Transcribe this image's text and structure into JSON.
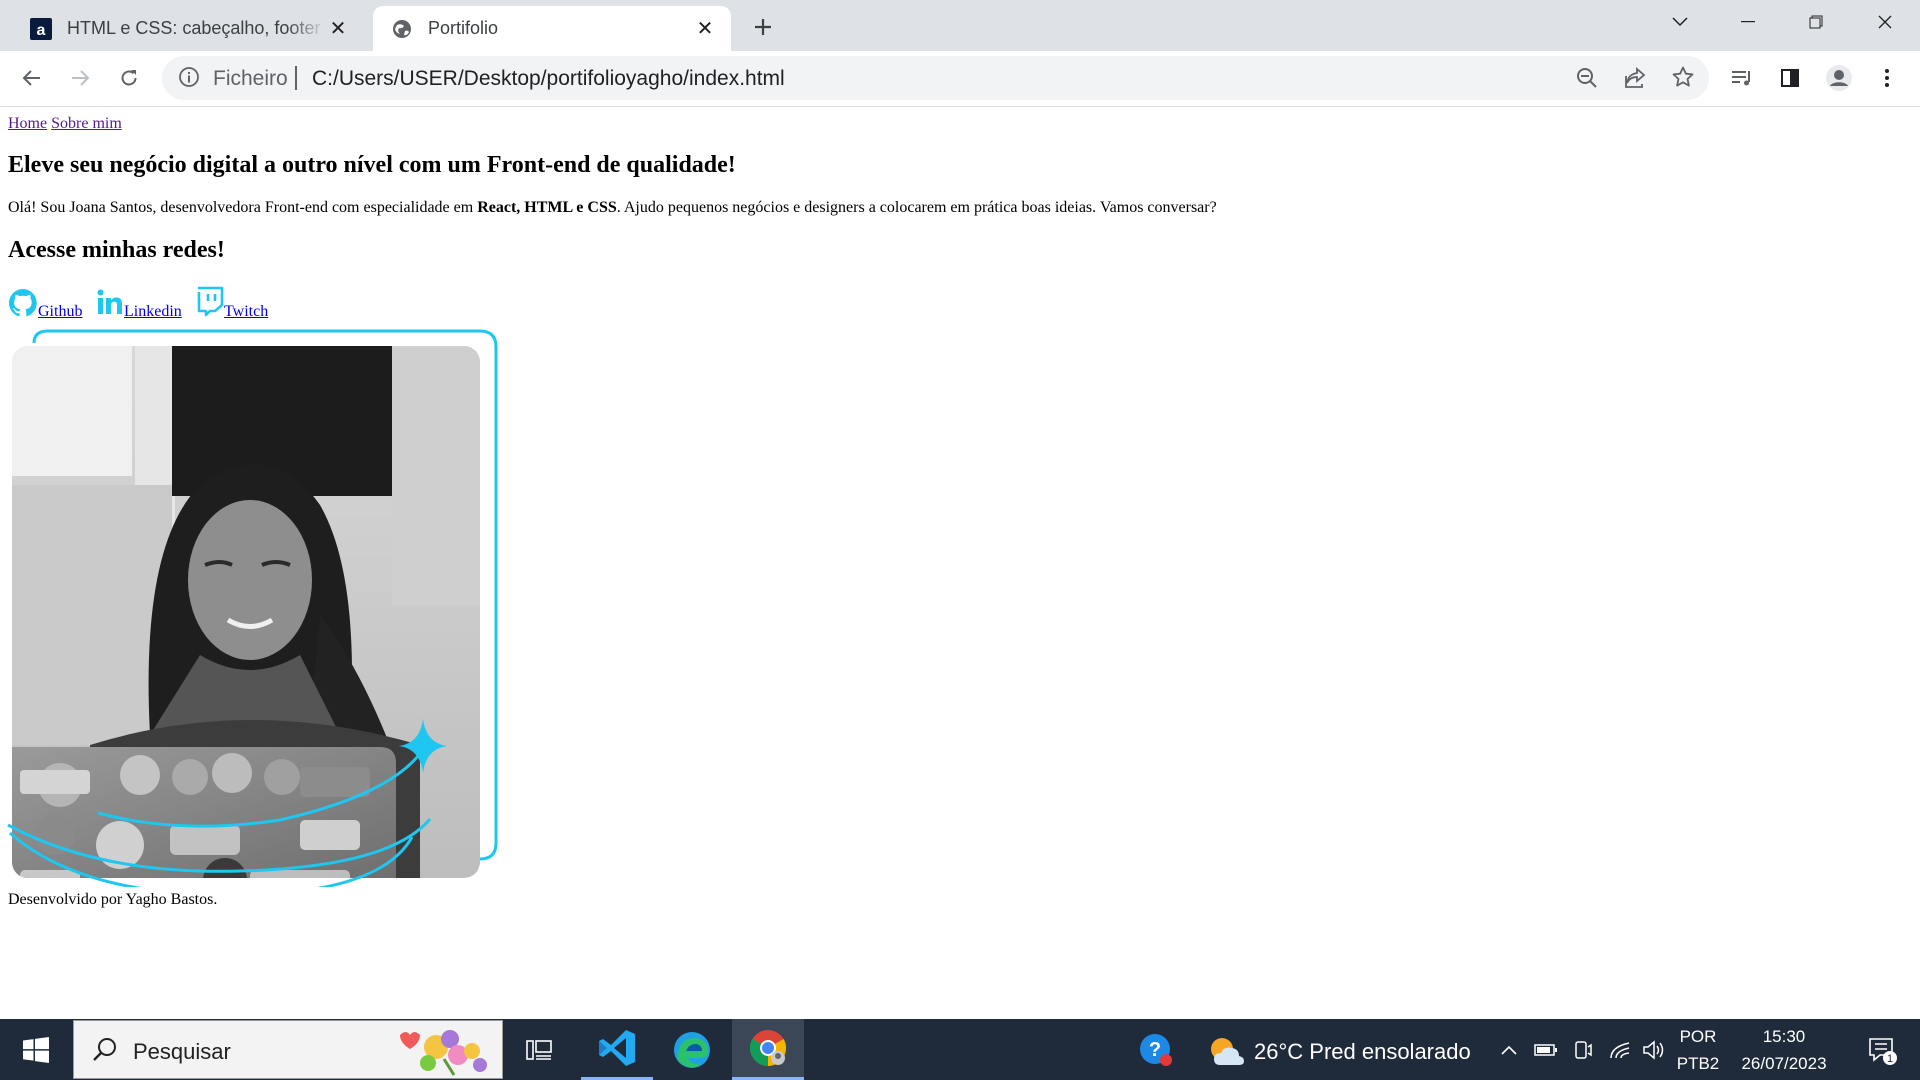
{
  "browser": {
    "tabs": [
      {
        "title": "HTML e CSS: cabeçalho, footer e",
        "favicon": "alura-icon",
        "active": false
      },
      {
        "title": "Portifolio",
        "favicon": "globe-icon",
        "active": true
      }
    ],
    "scheme_label": "Ficheiro",
    "url": "C:/Users/USER/Desktop/portifolioyagho/index.html"
  },
  "page": {
    "nav": {
      "home": "Home",
      "about": "Sobre mim"
    },
    "headline": "Eleve seu negócio digital a outro nível com um Front-end de qualidade!",
    "intro_before": "Olá! Sou Joana Santos, desenvolvedora Front-end com especialidade em ",
    "intro_bold": "React, HTML e CSS",
    "intro_after": ". Ajudo pequenos negócios e designers a colocarem em prática boas ideias. Vamos conversar?",
    "social_heading": "Acesse minhas redes!",
    "social_links": [
      {
        "label": " Github",
        "icon": "github-icon"
      },
      {
        "label": " Linkedin",
        "icon": "linkedin-icon"
      },
      {
        "label": " Twitch",
        "icon": "twitch-icon"
      }
    ],
    "footer": "Desenvolvido por Yagho Bastos.",
    "accent_color": "#1ec6f0"
  },
  "taskbar": {
    "search_placeholder": "Pesquisar",
    "weather": "26°C  Pred ensolarado",
    "lang_top": "POR",
    "lang_bottom": "PTB2",
    "time": "15:30",
    "date": "26/07/2023",
    "notifications": "1"
  }
}
